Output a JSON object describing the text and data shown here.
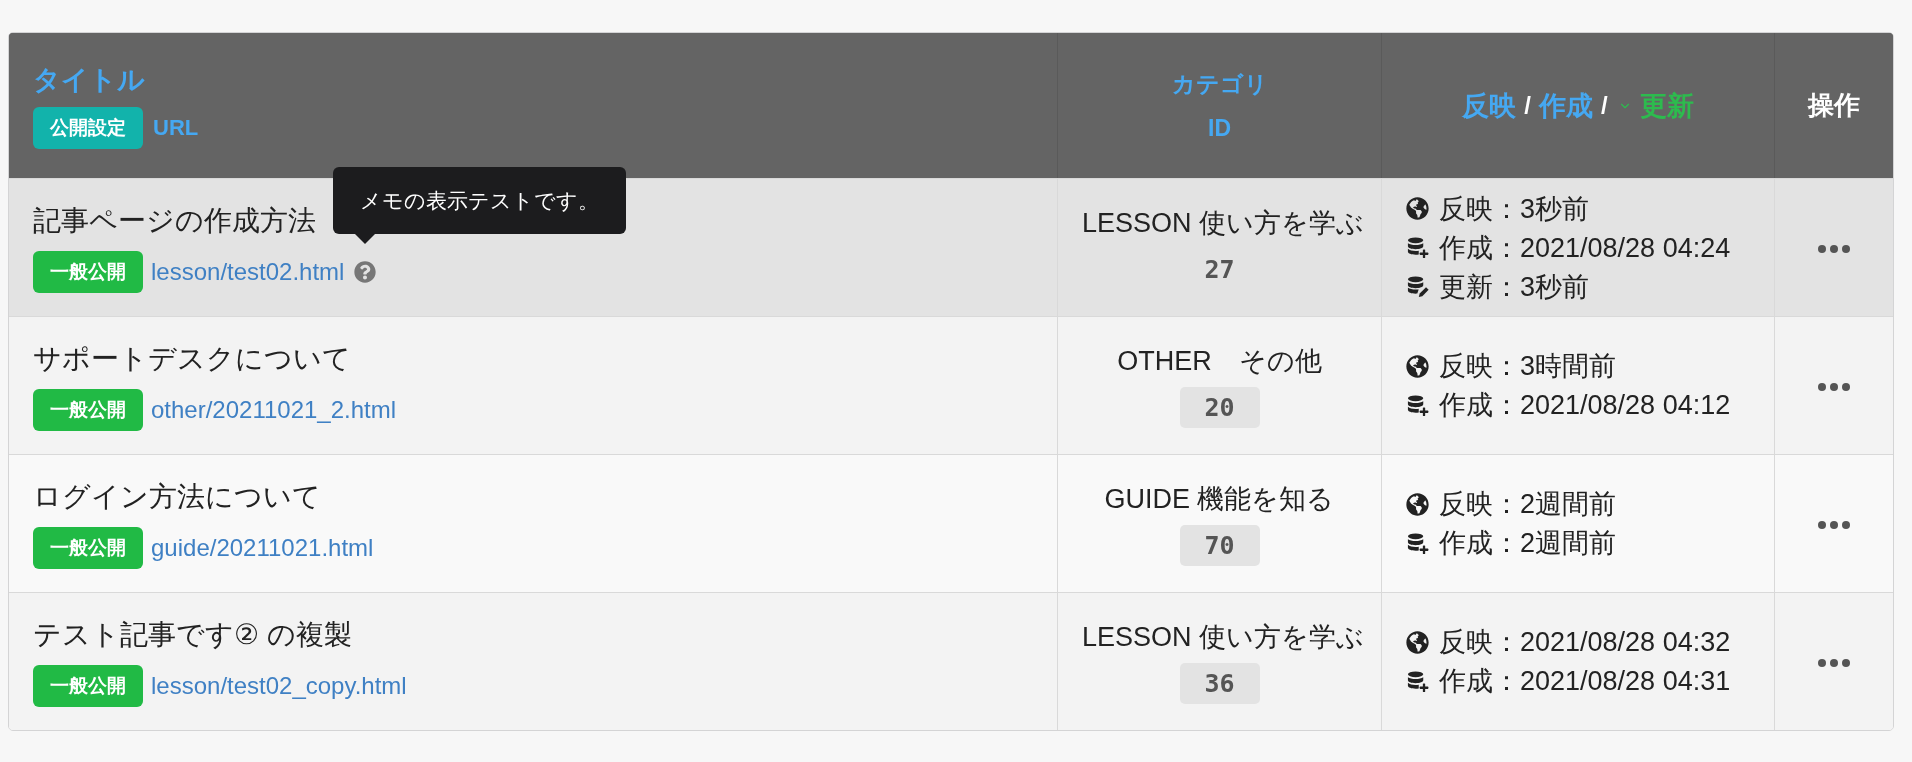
{
  "table": {
    "header": {
      "title": {
        "label": "タイトル",
        "badge": "公開設定",
        "sublabel": "URL"
      },
      "category": {
        "label": "カテゴリ",
        "sublabel": "ID"
      },
      "dates": {
        "sorts": [
          {
            "label": "反映",
            "selected": false,
            "separator": "/"
          },
          {
            "label": "作成",
            "selected": false,
            "separator": "/"
          },
          {
            "label": "更新",
            "selected": true
          }
        ]
      },
      "actions": {
        "label": "操作"
      }
    },
    "rows": [
      {
        "highlighted": true,
        "title": "記事ページの作成方法",
        "visibility": {
          "label": "一般公開",
          "kind": "public"
        },
        "url": "lesson/test02.html",
        "memo": {
          "tooltip": "メモの表示テストです。",
          "open": true
        },
        "category": "LESSON 使い方を学ぶ",
        "id": "27",
        "dates": [
          {
            "kind": "published",
            "text": "反映：3秒前"
          },
          {
            "kind": "created",
            "text": "作成：2021/08/28 04:24"
          },
          {
            "kind": "updated",
            "text": "更新：3秒前"
          }
        ]
      },
      {
        "highlighted": false,
        "title": "サポートデスクについて",
        "visibility": {
          "label": "一般公開",
          "kind": "public"
        },
        "url": "other/20211021_2.html",
        "category": "OTHER　その他",
        "id": "20",
        "dates": [
          {
            "kind": "published",
            "text": "反映：3時間前"
          },
          {
            "kind": "created",
            "text": "作成：2021/08/28 04:12"
          }
        ]
      },
      {
        "highlighted": false,
        "title": "ログイン方法について",
        "visibility": {
          "label": "一般公開",
          "kind": "public"
        },
        "url": "guide/20211021.html",
        "category": "GUIDE 機能を知る",
        "id": "70",
        "dates": [
          {
            "kind": "published",
            "text": "反映：2週間前"
          },
          {
            "kind": "created",
            "text": "作成：2週間前"
          }
        ]
      },
      {
        "highlighted": false,
        "title": "テスト記事です② の複製",
        "visibility": {
          "label": "一般公開",
          "kind": "public"
        },
        "url": "lesson/test02_copy.html",
        "category": "LESSON 使い方を学ぶ",
        "id": "36",
        "dates": [
          {
            "kind": "published",
            "text": "反映：2021/08/28 04:32"
          },
          {
            "kind": "created",
            "text": "作成：2021/08/28 04:31"
          }
        ]
      }
    ]
  }
}
